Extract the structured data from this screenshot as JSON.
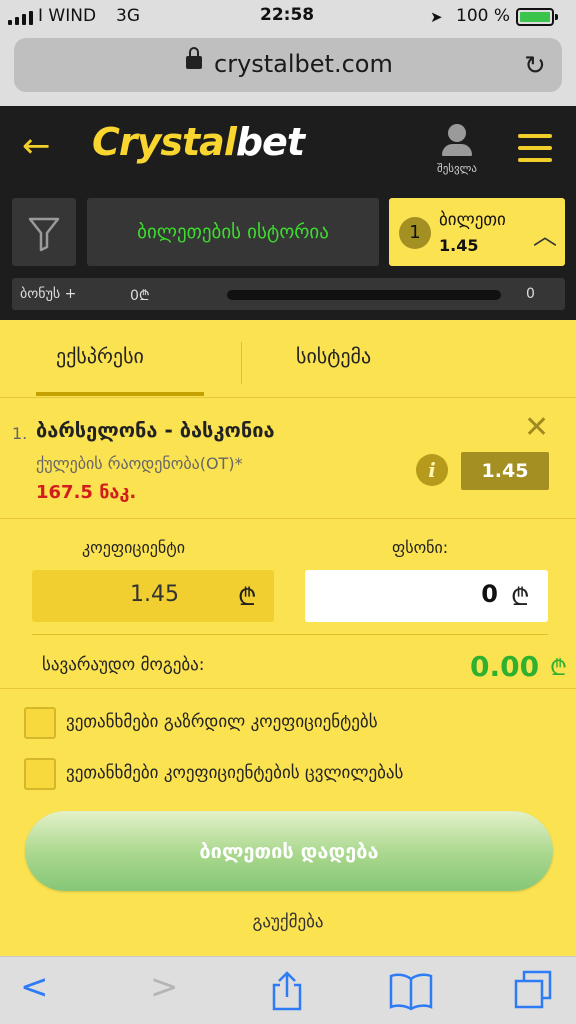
{
  "status_bar": {
    "carrier": "I WIND",
    "network": "3G",
    "time": "22:58",
    "battery": "100 %"
  },
  "browser": {
    "url": "crystalbet.com"
  },
  "header": {
    "logo_part1": "Crystal",
    "logo_part2": "bet",
    "login_label": "შესვლა"
  },
  "nav": {
    "history_label": "ბილეთების ისტორია",
    "ticket_count": "1",
    "ticket_label": "ბილეთი",
    "ticket_odds": "1.45"
  },
  "bonus": {
    "label": "ბონუს +",
    "amount": "0₾",
    "count": "0",
    "progress": 0
  },
  "tabs": {
    "express": "ექსპრესი",
    "system": "სისტემა"
  },
  "bet": {
    "index": "1.",
    "match": "ბარსელონა - ბასკონია",
    "market": "ქულების რაოდენობა(OT)*",
    "line": "167.5 ნაკ.",
    "odds": "1.45"
  },
  "stake": {
    "coef_label": "კოეფიციენტი",
    "coef_value": "1.45",
    "stake_label": "ფსონი:",
    "stake_value": "0",
    "currency": "₾",
    "win_label": "სავარაუდო მოგება:",
    "win_value": "0.00"
  },
  "options": {
    "accept_higher": "ვეთანხმები გაზრდილ კოეფიციენტებს",
    "accept_changes": "ვეთანხმები კოეფიციენტების ცვლილებას"
  },
  "actions": {
    "place_bet": "ბილეთის დადება",
    "cancel": "გაუქმება"
  }
}
